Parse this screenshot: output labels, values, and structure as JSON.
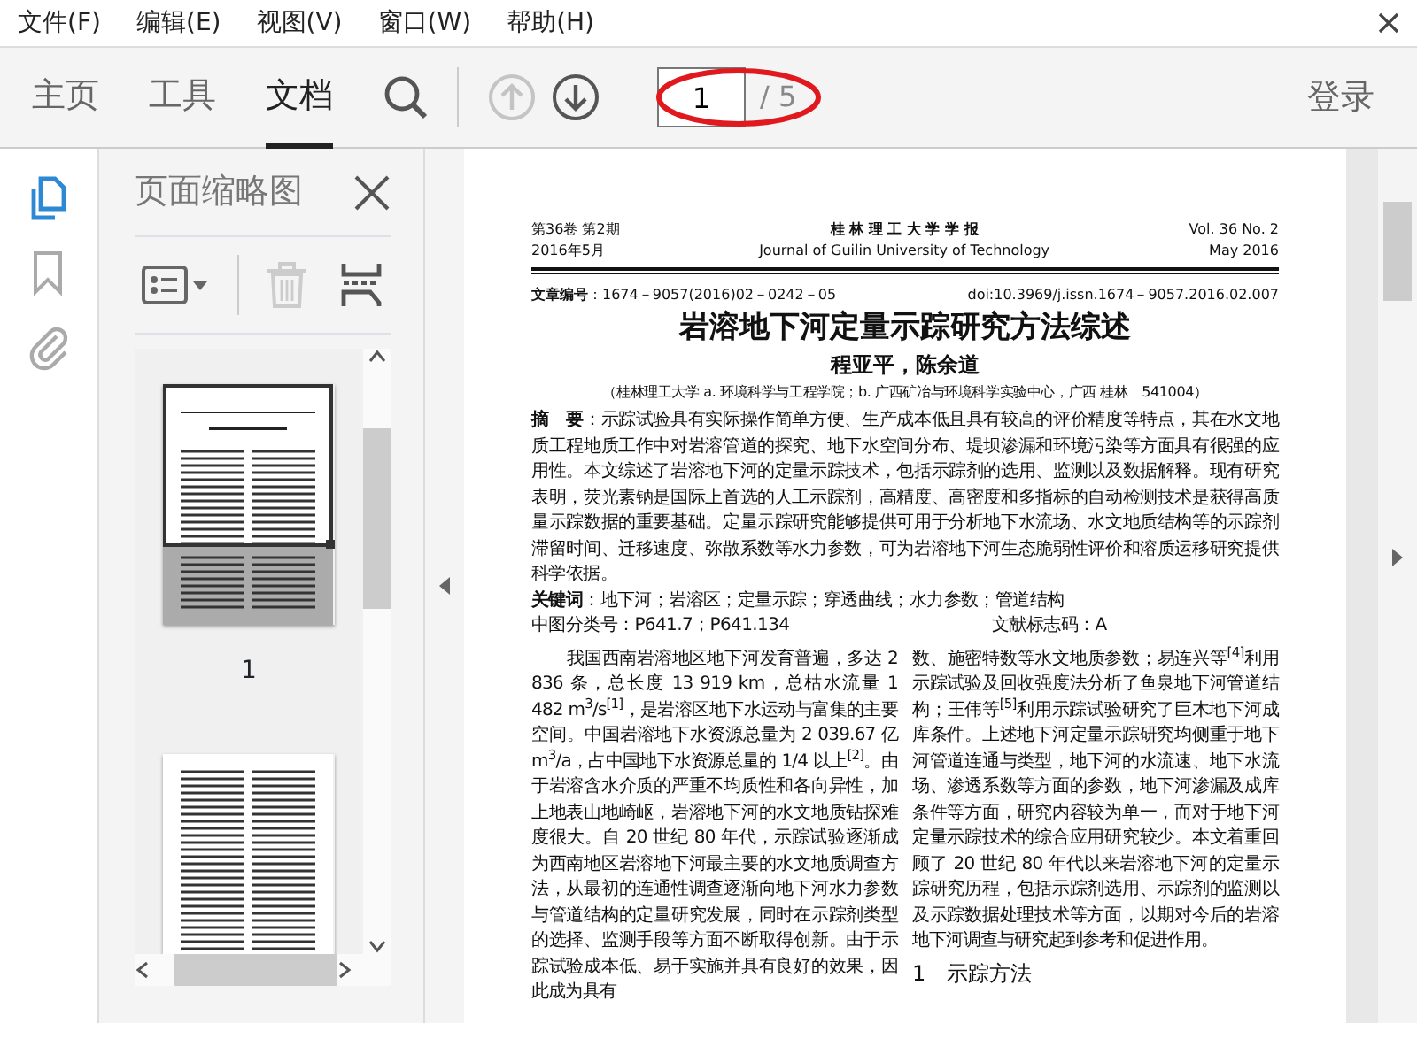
{
  "menu": [
    "文件(F)",
    "编辑(E)",
    "视图(V)",
    "窗口(W)",
    "帮助(H)"
  ],
  "toolbar": {
    "tabs": [
      {
        "label": "主页",
        "selected": false
      },
      {
        "label": "工具",
        "selected": false
      },
      {
        "label": "文档",
        "selected": true
      }
    ],
    "prev_page": {
      "disabled": true
    },
    "next_page": {
      "disabled": false
    },
    "page_field": {
      "value": "1"
    },
    "page_total": "/ 5",
    "login": "登录"
  },
  "sidebar": {
    "panels": [
      {
        "kind": "pages",
        "selected": true
      },
      {
        "kind": "bookmarks",
        "selected": false
      },
      {
        "kind": "attachments",
        "selected": false
      }
    ]
  },
  "thumbnails": {
    "title": "页面缩略图",
    "delete_disabled": true,
    "pages": [
      {
        "label": "1",
        "selected": true
      },
      {
        "selected": false
      }
    ]
  },
  "document": {
    "header_left": [
      "第36卷 第2期",
      "2016年5月"
    ],
    "header_center": [
      "桂 林 理 工 大 学 学 报",
      "Journal of Guilin University of Technology"
    ],
    "header_right": [
      "Vol. 36 No. 2",
      "May  2016"
    ],
    "article_no": "**文章编号**：1674－9057(2016)02－0242－05",
    "doi": "doi:10.3969/j.issn.1674－9057.2016.02.007",
    "title": "岩溶地下河定量示踪研究方法综述",
    "authors": "程亚平，陈余道",
    "affiliation": "（桂林理工大学 a. 环境科学与工程学院；b. 广西矿冶与环境科学实验中心，广西 桂林　541004）",
    "abstract": "**摘　要**：示踪试验具有实际操作简单方便、生产成本低且具有较高的评价精度等特点，其在水文地质工程地质工作中对岩溶管道的探究、地下水空间分布、堤坝渗漏和环境污染等方面具有很强的应用性。本文综述了岩溶地下河的定量示踪技术，包括示踪剂的选用、监测以及数据解释。现有研究表明，荧光素钠是国际上首选的人工示踪剂，高精度、高密度和多指标的自动检测技术是获得高质量示踪数据的重要基础。定量示踪研究能够提供可用于分析地下水流场、水文地质结构等的示踪剂滞留时间、迁移速度、弥散系数等水力参数，可为岩溶地下河生态脆弱性评价和溶质运移研究提供科学依据。",
    "keywords": "**关键词**：地下河；岩溶区；定量示踪；穿透曲线；水力参数；管道结构",
    "clc": "中图分类号：P641.7；P641.134",
    "doc_code": "文献标志码：A",
    "left_column": "我国西南岩溶地区地下河发育普遍，多达 2 836 条，总长度 13 919 km，总枯水流量 1 482 m$^{3}$/s$^{[1]}$，是岩溶区地下水运动与富集的主要空间。中国岩溶地下水资源总量为 2 039.67 亿 m$^{3}$/a，占中国地下水资源总量的 1/4 以上$^{[2]}$。由于岩溶含水介质的严重不均质性和各向异性，加上地表山地崎岖，岩溶地下河的水文地质钻探难度很大。自 20 世纪 80 年代，示踪试验逐渐成为西南地区岩溶地下河最主要的水文地质调查方法，从最初的连通性调查逐渐向地下河水力参数与管道结构的定量研究发展，同时在示踪剂类型的选择、监测手段等方面不断取得创新。由于示踪试验成本低、易于实施并具有良好的效果，因此成为具有",
    "right_column": "数、施密特数等水文地质参数；易连兴等$^{[4]}$利用示踪试验及回收强度法分析了鱼泉地下河管道结构；王伟等$^{[5]}$利用示踪试验研究了巨木地下河成库条件。上述地下河定量示踪研究均侧重于地下河管道连通与类型，地下河的水流速、地下水流场、渗透系数等方面的参数，地下河渗漏及成库条件等方面，研究内容较为单一，而对于地下河定量示踪技术的综合应用研究较少。本文着重回顾了 20 世纪 80 年代以来岩溶地下河的定量示踪研究历程，包括示踪剂选用、示踪剂的监测以及示踪数据处理技术等方面，以期对今后的岩溶地下河调查与研究起到参考和促进作用。",
    "section_heading": "1　示踪方法"
  }
}
